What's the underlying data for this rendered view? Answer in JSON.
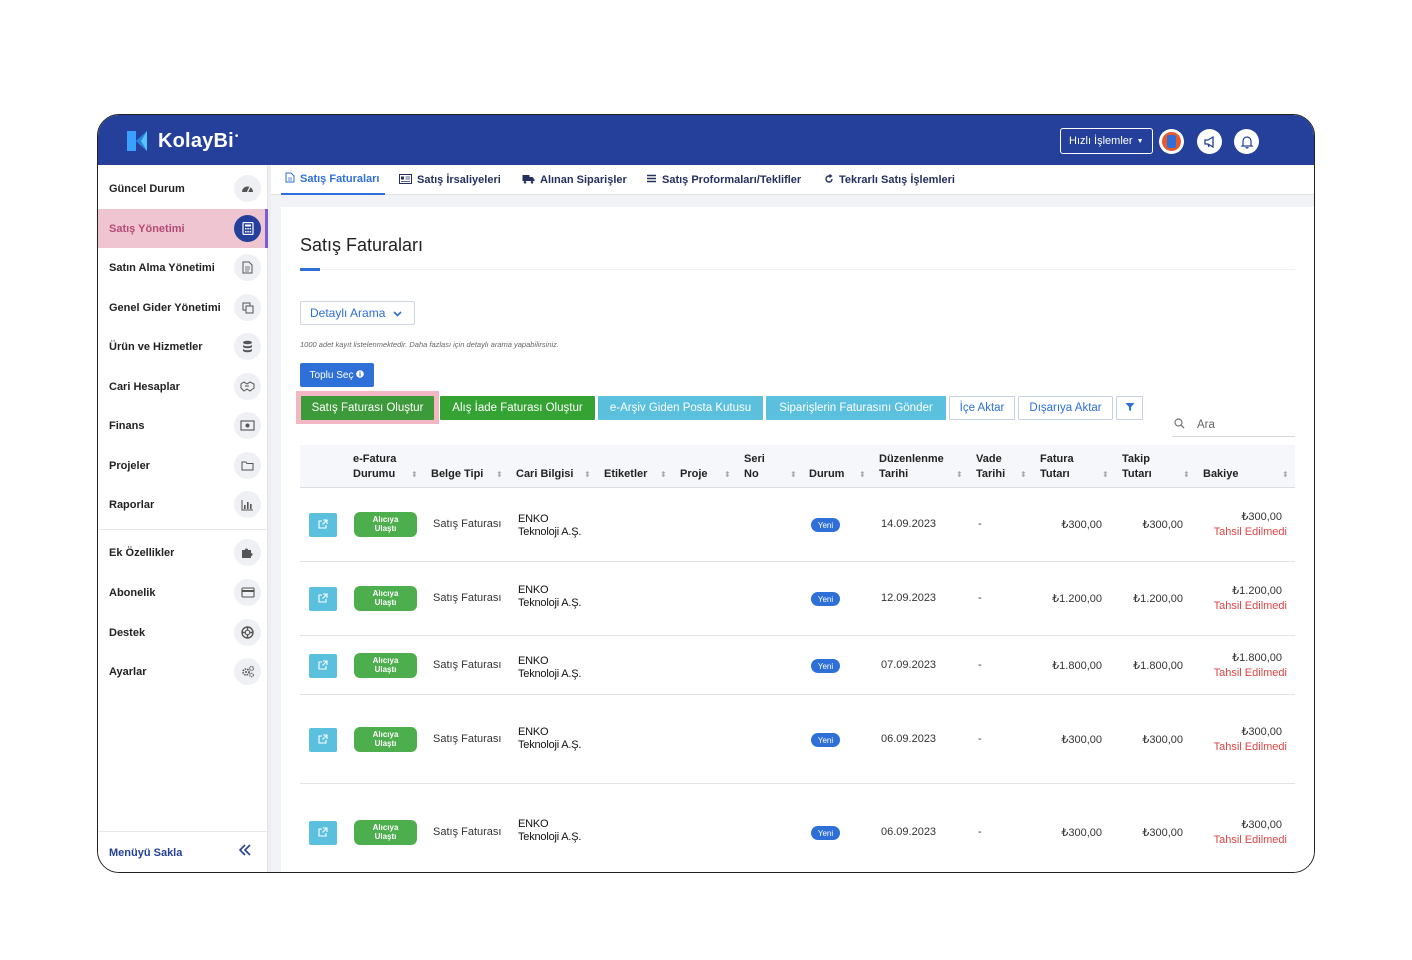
{
  "app": {
    "logo_text": "KolayBi",
    "hizli_label": "Hızlı İşlemler"
  },
  "colors": {
    "brand": "#24409a",
    "accent": "#2f6fd8",
    "green": "#34a334",
    "cyan": "#5bc0de",
    "danger": "#e04444"
  },
  "sidebar": {
    "items": [
      {
        "label": "Güncel Durum",
        "icon": "dashboard-icon"
      },
      {
        "label": "Satış Yönetimi",
        "icon": "calculator-icon"
      },
      {
        "label": "Satın Alma Yönetimi",
        "icon": "document-icon"
      },
      {
        "label": "Genel Gider Yönetimi",
        "icon": "copy-icon"
      },
      {
        "label": "Ürün ve Hizmetler",
        "icon": "database-icon"
      },
      {
        "label": "Cari Hesaplar",
        "icon": "handshake-icon"
      },
      {
        "label": "Finans",
        "icon": "money-icon"
      },
      {
        "label": "Projeler",
        "icon": "folder-icon"
      },
      {
        "label": "Raporlar",
        "icon": "chart-icon"
      },
      {
        "label": "Ek Özellikler",
        "icon": "puzzle-icon"
      },
      {
        "label": "Abonelik",
        "icon": "credit-card-icon"
      },
      {
        "label": "Destek",
        "icon": "lifebuoy-icon"
      },
      {
        "label": "Ayarlar",
        "icon": "gears-icon"
      }
    ],
    "footer_label": "Menüyü Sakla"
  },
  "tabs": [
    {
      "label": "Satış Faturaları",
      "icon": "file-icon"
    },
    {
      "label": "Satış İrsaliyeleri",
      "icon": "id-card-icon"
    },
    {
      "label": "Alınan Siparişler",
      "icon": "truck-icon"
    },
    {
      "label": "Satış Proformaları/Teklifler",
      "icon": "list-icon"
    },
    {
      "label": "Tekrarlı Satış İşlemleri",
      "icon": "refresh-icon"
    }
  ],
  "page": {
    "title": "Satış Faturaları",
    "detayli_label": "Detaylı Arama",
    "hint": "1000 adet kayıt listelenmektedir. Daha fazlası için detaylı arama yapabilirsiniz.",
    "toplu_label": "Toplu Seç",
    "search_placeholder": "Ara"
  },
  "actions": [
    "Satış Faturası Oluştur",
    "Alış İade Faturası Oluştur",
    "e-Arşiv Giden Posta Kutusu",
    "Siparişlerin Faturasını Gönder",
    "İçe Aktar",
    "Dışarıya Aktar"
  ],
  "table": {
    "headers": {
      "efatura": [
        "e-Fatura",
        "Durumu"
      ],
      "belge": "Belge Tipi",
      "cari": "Cari Bilgisi",
      "etiket": "Etiketler",
      "proje": "Proje",
      "seri": [
        "Seri",
        "No"
      ],
      "durum": "Durum",
      "duzenlenme": [
        "Düzenlenme",
        "Tarihi"
      ],
      "vade": [
        "Vade",
        "Tarihi"
      ],
      "fatura": [
        "Fatura",
        "Tutarı"
      ],
      "takip": [
        "Takip",
        "Tutarı"
      ],
      "bakiye": "Bakiye"
    },
    "rows": [
      {
        "efatura": [
          "Alıcıya",
          "Ulaştı"
        ],
        "belge": "Satış Faturası",
        "cari": [
          "ENKO",
          "Teknoloji A.Ş."
        ],
        "durum": "Yeni",
        "duzenlenme": "14.09.2023",
        "vade": "-",
        "fatura": "₺300,00",
        "takip": "₺300,00",
        "bakiye": "₺300,00",
        "tahsil": "Tahsil Edilmedi"
      },
      {
        "efatura": [
          "Alıcıya",
          "Ulaştı"
        ],
        "belge": "Satış Faturası",
        "cari": [
          "ENKO",
          "Teknoloji A.Ş."
        ],
        "durum": "Yeni",
        "duzenlenme": "12.09.2023",
        "vade": "-",
        "fatura": "₺1.200,00",
        "takip": "₺1.200,00",
        "bakiye": "₺1.200,00",
        "tahsil": "Tahsil Edilmedi"
      },
      {
        "efatura": [
          "Alıcıya",
          "Ulaştı"
        ],
        "belge": "Satış Faturası",
        "cari": [
          "ENKO",
          "Teknoloji A.Ş."
        ],
        "durum": "Yeni",
        "duzenlenme": "07.09.2023",
        "vade": "-",
        "fatura": "₺1.800,00",
        "takip": "₺1.800,00",
        "bakiye": "₺1.800,00",
        "tahsil": "Tahsil Edilmedi"
      },
      {
        "efatura": [
          "Alıcıya",
          "Ulaştı"
        ],
        "belge": "Satış Faturası",
        "cari": [
          "ENKO",
          "Teknoloji A.Ş."
        ],
        "durum": "Yeni",
        "duzenlenme": "06.09.2023",
        "vade": "-",
        "fatura": "₺300,00",
        "takip": "₺300,00",
        "bakiye": "₺300,00",
        "tahsil": "Tahsil Edilmedi"
      },
      {
        "efatura": [
          "Alıcıya",
          "Ulaştı"
        ],
        "belge": "Satış Faturası",
        "cari": [
          "ENKO",
          "Teknoloji A.Ş."
        ],
        "durum": "Yeni",
        "duzenlenme": "06.09.2023",
        "vade": "-",
        "fatura": "₺300,00",
        "takip": "₺300,00",
        "bakiye": "₺300,00",
        "tahsil": "Tahsil Edilmedi"
      }
    ]
  }
}
